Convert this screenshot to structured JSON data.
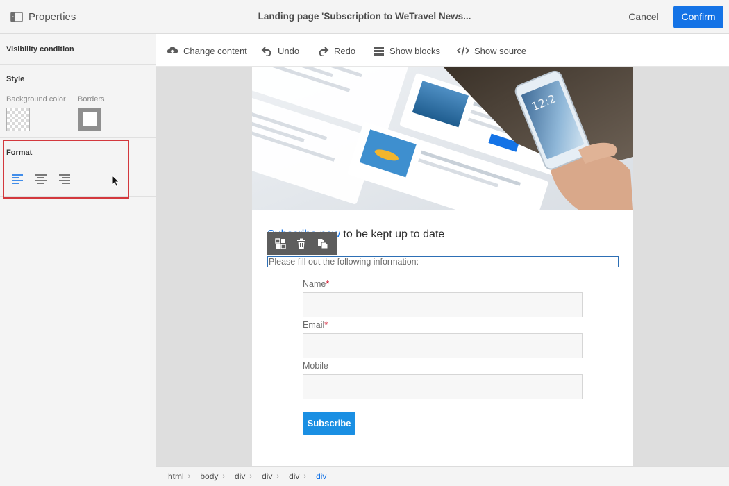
{
  "header": {
    "panel_title": "Properties",
    "doc_title": "Landing page 'Subscription to WeTravel News...",
    "cancel_label": "Cancel",
    "confirm_label": "Confirm"
  },
  "left_panel": {
    "visibility_label": "Visibility condition",
    "style_heading": "Style",
    "background_color_label": "Background color",
    "borders_label": "Borders",
    "format_heading": "Format",
    "align_buttons": [
      {
        "name": "align-left-icon",
        "active": true
      },
      {
        "name": "align-center-icon",
        "active": false
      },
      {
        "name": "align-right-icon",
        "active": false
      }
    ]
  },
  "toolbar": {
    "change_content": "Change content",
    "undo": "Undo",
    "redo": "Redo",
    "show_blocks": "Show blocks",
    "show_source": "Show source"
  },
  "content": {
    "headline_link": "Subscribe now",
    "headline_text": " to be kept up to date",
    "selected_paragraph": "Please fill out the following information:",
    "fields": [
      {
        "label": "Name",
        "required": true
      },
      {
        "label": "Email",
        "required": true
      },
      {
        "label": "Mobile",
        "required": false
      }
    ],
    "subscribe_label": "Subscribe"
  },
  "block_toolbar": [
    "blocks-icon",
    "trash-icon",
    "duplicate-icon"
  ],
  "breadcrumb": [
    "html",
    "body",
    "div",
    "div",
    "div",
    "div"
  ],
  "colors": {
    "accent": "#1473e6",
    "subscribe": "#1a8fe3",
    "highlight": "#d3383d",
    "required": "#d0021b"
  }
}
